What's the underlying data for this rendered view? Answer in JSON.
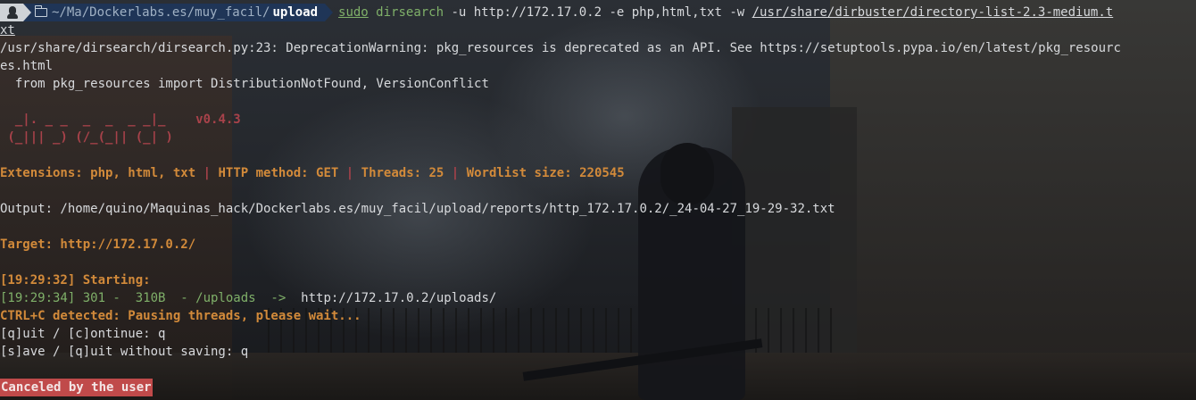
{
  "prompt": {
    "os_icon": "linux-tux-icon",
    "folder_icon": "folder-open-icon",
    "path_prefix": "~/Ma/Dockerlabs.es/muy_facil/",
    "path_current": "upload"
  },
  "command": {
    "sudo": "sudo",
    "bin": "dirsearch",
    "args": " -u http://172.17.0.2 -e php,html,txt -w ",
    "wordlist": "/usr/share/dirbuster/directory-list-2.3-medium.t",
    "wrap": "xt"
  },
  "warning": {
    "line1": "/usr/share/dirsearch/dirsearch.py:23: DeprecationWarning: pkg_resources is deprecated as an API. See https://setuptools.pypa.io/en/latest/pkg_resourc",
    "line2": "es.html",
    "line3": "  from pkg_resources import DistributionNotFound, VersionConflict"
  },
  "banner": {
    "row1": "  _|. _ _  _  _  _ _|_",
    "version": "v0.4.3",
    "row2": " (_||| _) (/_(_|| (_| )"
  },
  "config": {
    "ext_label": "Extensions: ",
    "ext_value": "php, html, txt",
    "sep": " | ",
    "method_label": "HTTP method: ",
    "method_value": "GET",
    "threads_label": "Threads: ",
    "threads_value": "25",
    "wordlist_label": "Wordlist size: ",
    "wordlist_value": "220545"
  },
  "output_line": "Output: /home/quino/Maquinas_hack/Dockerlabs.es/muy_facil/upload/reports/http_172.17.0.2/_24-04-27_19-29-32.txt",
  "target_line": "Target: http://172.17.0.2/",
  "starting_line": "[19:29:32] Starting:",
  "result": {
    "prefix": "[19:29:34] 301 -  310B  - /uploads  ->  ",
    "url": "http://172.17.0.2/uploads/"
  },
  "ctrl_c_line": "CTRL+C detected: Pausing threads, please wait...",
  "prompt_quit": "[q]uit / [c]ontinue: q",
  "prompt_save": "[s]ave / [q]uit without saving: q",
  "canceled": "Canceled by the user",
  "colors": {
    "background": "#1e2126",
    "text": "#d7d9dc",
    "orange": "#d28a3a",
    "red": "#a8424a",
    "green": "#7fb069",
    "path_bg": "#1f3557",
    "badge_bg": "#c04a4a"
  }
}
